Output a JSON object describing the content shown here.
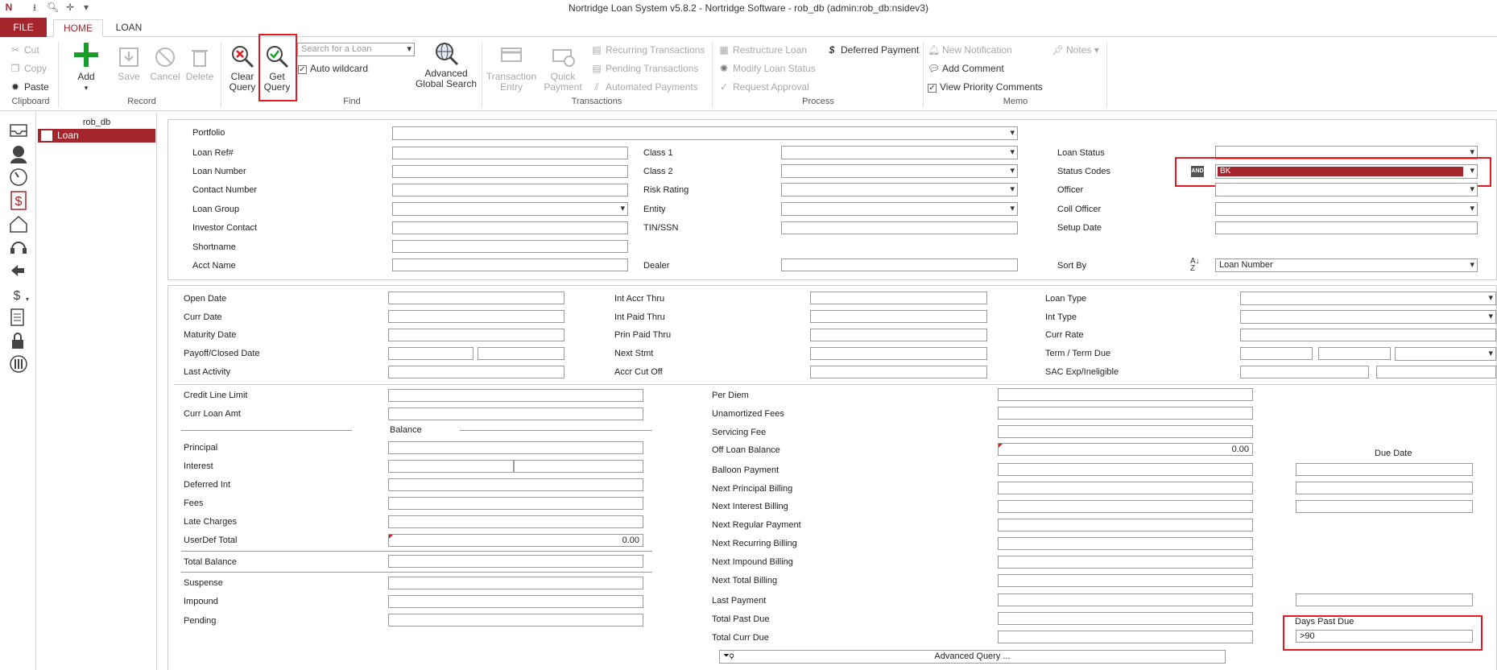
{
  "window_title": "Nortridge Loan System v5.8.2 - Nortridge Software - rob_db (admin:rob_db:nsidev3)",
  "tabs": {
    "file": "FILE",
    "home": "HOME",
    "loan": "LOAN"
  },
  "ribbon": {
    "clipboard": {
      "label": "Clipboard",
      "cut": "Cut",
      "copy": "Copy",
      "paste": "Paste"
    },
    "record": {
      "label": "Record",
      "add": "Add",
      "save": "Save",
      "cancel": "Cancel",
      "delete": "Delete"
    },
    "find": {
      "label": "Find",
      "clear_query_1": "Clear",
      "clear_query_2": "Query",
      "get_query_1": "Get",
      "get_query_2": "Query",
      "search_placeholder": "Search for a Loan",
      "auto_wildcard": "Auto wildcard",
      "advanced_1": "Advanced",
      "advanced_2": "Global Search"
    },
    "transactions": {
      "label": "Transactions",
      "entry_1": "Transaction",
      "entry_2": "Entry",
      "quick_1": "Quick",
      "quick_2": "Payment",
      "recurring": "Recurring Transactions",
      "pending": "Pending Transactions",
      "automated": "Automated Payments"
    },
    "process": {
      "label": "Process",
      "restructure": "Restructure Loan",
      "deferred": "Deferred Payment",
      "modify_status": "Modify Loan Status",
      "request_approval": "Request Approval"
    },
    "memo": {
      "label": "Memo",
      "new_notification": "New Notification",
      "add_comment": "Add Comment",
      "view_priority": "View Priority Comments",
      "notes": "Notes"
    }
  },
  "nav": {
    "db": "rob_db",
    "loan": "Loan"
  },
  "query": {
    "portfolio": "Portfolio",
    "loan_ref": "Loan Ref#",
    "loan_number": "Loan Number",
    "contact_number": "Contact Number",
    "loan_group": "Loan Group",
    "investor_contact": "Investor Contact",
    "shortname": "Shortname",
    "acct_name": "Acct Name",
    "class1": "Class 1",
    "class2": "Class 2",
    "risk_rating": "Risk Rating",
    "entity": "Entity",
    "tin_ssn": "TIN/SSN",
    "dealer": "Dealer",
    "loan_status": "Loan Status",
    "status_codes": "Status Codes",
    "officer": "Officer",
    "coll_officer": "Coll Officer",
    "setup_date": "Setup Date",
    "sort_by": "Sort By",
    "sort_by_value": "Loan Number",
    "and_badge": "AND",
    "status_codes_value": "BK"
  },
  "dates": {
    "open_date": "Open Date",
    "curr_date": "Curr Date",
    "maturity_date": "Maturity Date",
    "payoff_closed": "Payoff/Closed Date",
    "last_activity": "Last Activity",
    "int_accr_thru": "Int Accr Thru",
    "int_paid_thru": "Int Paid Thru",
    "prin_paid_thru": "Prin Paid Thru",
    "next_stmt": "Next Stmt",
    "accr_cut_off": "Accr Cut Off",
    "loan_type": "Loan Type",
    "int_type": "Int Type",
    "curr_rate": "Curr Rate",
    "term_due": "Term / Term Due",
    "sac_exp": "SAC Exp/Ineligible"
  },
  "amounts": {
    "credit_line_limit": "Credit Line Limit",
    "curr_loan_amt": "Curr Loan Amt",
    "balance_hdr": "Balance",
    "principal": "Principal",
    "interest": "Interest",
    "deferred_int": "Deferred Int",
    "fees": "Fees",
    "late_charges": "Late Charges",
    "userdef_total": "UserDef Total",
    "userdef_total_value": "0.00",
    "total_balance": "Total Balance",
    "suspense": "Suspense",
    "impound": "Impound",
    "pending": "Pending",
    "per_diem": "Per Diem",
    "unamortized_fees": "Unamortized Fees",
    "servicing_fee": "Servicing Fee",
    "off_loan_balance": "Off Loan Balance",
    "off_loan_balance_value": "0.00",
    "balloon_payment": "Balloon Payment",
    "next_principal_billing": "Next Principal Billing",
    "next_interest_billing": "Next Interest Billing",
    "next_regular_payment": "Next Regular Payment",
    "next_recurring_billing": "Next Recurring Billing",
    "next_impound_billing": "Next Impound Billing",
    "next_total_billing": "Next Total Billing",
    "last_payment": "Last Payment",
    "total_past_due": "Total Past Due",
    "total_curr_due": "Total Curr Due",
    "due_date": "Due Date",
    "days_past_due": "Days Past Due",
    "days_past_due_value": ">90",
    "advanced_query": "Advanced Query ..."
  }
}
